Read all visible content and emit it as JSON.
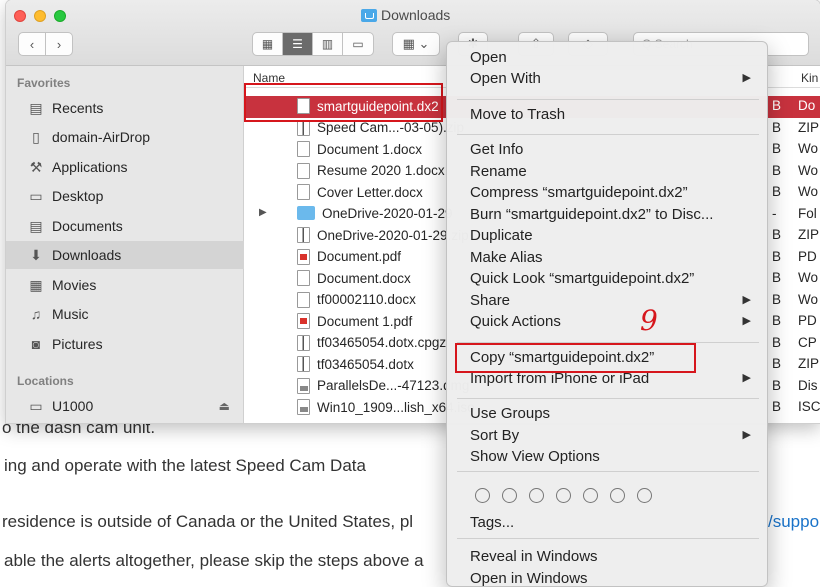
{
  "window": {
    "title": "Downloads"
  },
  "toolbar": {
    "back": "‹",
    "forward": "›",
    "search_placeholder": "Q Search"
  },
  "sidebar": {
    "favorites_header": "Favorites",
    "locations_header": "Locations",
    "items": [
      {
        "label": "Recents",
        "icon": "recents-icon"
      },
      {
        "label": "domain-AirDrop",
        "icon": "airdrop-icon"
      },
      {
        "label": "Applications",
        "icon": "applications-icon"
      },
      {
        "label": "Desktop",
        "icon": "desktop-icon"
      },
      {
        "label": "Documents",
        "icon": "documents-icon"
      },
      {
        "label": "Downloads",
        "icon": "downloads-icon",
        "selected": true
      },
      {
        "label": "Movies",
        "icon": "movies-icon"
      },
      {
        "label": "Music",
        "icon": "music-icon"
      },
      {
        "label": "Pictures",
        "icon": "pictures-icon"
      }
    ],
    "location_items": [
      {
        "label": "U1000",
        "icon": "drive-icon"
      }
    ]
  },
  "filelist": {
    "columns": {
      "name": "Name",
      "kind": "Kin"
    },
    "rows": [
      {
        "name": "smartguidepoint.dx2",
        "size": "B",
        "kind": "Do",
        "selected": true,
        "type": "doc"
      },
      {
        "name": "Speed Cam...-03-05).zip",
        "size": "B",
        "kind": "ZIP",
        "type": "zip"
      },
      {
        "name": "Document 1.docx",
        "size": "B",
        "kind": "Wo",
        "type": "doc"
      },
      {
        "name": "Resume 2020 1.docx",
        "size": "B",
        "kind": "Wo",
        "type": "doc"
      },
      {
        "name": "Cover Letter.docx",
        "size": "B",
        "kind": "Wo",
        "type": "doc"
      },
      {
        "name": "OneDrive-2020-01-29",
        "size": "-",
        "kind": "Fol",
        "type": "folder"
      },
      {
        "name": "OneDrive-2020-01-29.zip",
        "size": "B",
        "kind": "ZIP",
        "type": "zip"
      },
      {
        "name": "Document.pdf",
        "size": "B",
        "kind": "PD",
        "type": "pdf"
      },
      {
        "name": "Document.docx",
        "size": "B",
        "kind": "Wo",
        "type": "doc"
      },
      {
        "name": "tf00002110.docx",
        "size": "B",
        "kind": "Wo",
        "type": "doc"
      },
      {
        "name": "Document 1.pdf",
        "size": "B",
        "kind": "PD",
        "type": "pdf"
      },
      {
        "name": "tf03465054.dotx.cpgz",
        "size": "B",
        "kind": "CP",
        "type": "zip"
      },
      {
        "name": "tf03465054.dotx",
        "size": "B",
        "kind": "ZIP",
        "type": "zip"
      },
      {
        "name": "ParallelsDe...-47123.dmg",
        "size": "B",
        "kind": "Dis",
        "type": "dmg"
      },
      {
        "name": "Win10_1909...lish_x64.iso",
        "size": "B",
        "kind": "ISC",
        "type": "dmg"
      }
    ]
  },
  "context_menu": {
    "items": [
      {
        "label": "Open"
      },
      {
        "label": "Open With",
        "submenu": true
      },
      {
        "label": "Move to Trash"
      },
      {
        "label": "Get Info"
      },
      {
        "label": "Rename"
      },
      {
        "label": "Compress “smartguidepoint.dx2”"
      },
      {
        "label": "Burn “smartguidepoint.dx2” to Disc..."
      },
      {
        "label": "Duplicate"
      },
      {
        "label": "Make Alias"
      },
      {
        "label": "Quick Look “smartguidepoint.dx2”"
      },
      {
        "label": "Share",
        "submenu": true
      },
      {
        "label": "Quick Actions",
        "submenu": true
      },
      {
        "label": "Copy “smartguidepoint.dx2”"
      },
      {
        "label": "Import from iPhone or iPad",
        "submenu": true
      },
      {
        "label": "Use Groups"
      },
      {
        "label": "Sort By",
        "submenu": true
      },
      {
        "label": "Show View Options"
      },
      {
        "label": "Tags..."
      },
      {
        "label": "Reveal in Windows"
      },
      {
        "label": "Open in Windows"
      }
    ]
  },
  "annotation": {
    "step_number": "9"
  },
  "background_page": {
    "line1": "o the dash cam unit.",
    "line2": "ing and operate with the latest Speed Cam Data",
    "line3": " residence is outside of Canada or the United States, pl",
    "line3_link": "/suppo",
    "line4": "able the alerts altogether, please skip the steps above a"
  },
  "colors": {
    "selection": "#c8323e",
    "annotation_red": "#d6161c"
  }
}
